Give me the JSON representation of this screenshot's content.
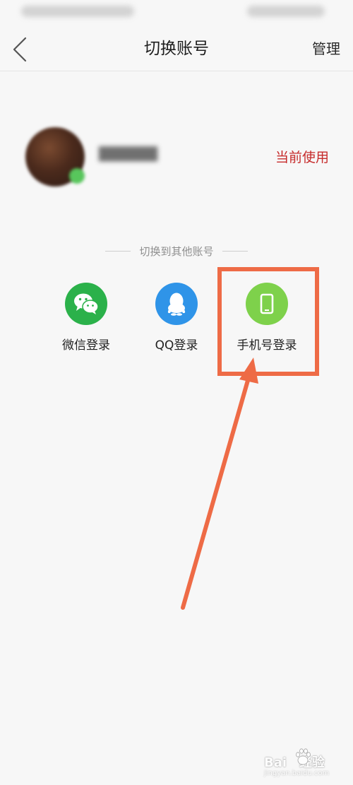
{
  "header": {
    "title": "切换账号",
    "manage_label": "管理",
    "back_icon": "chevron-left-icon"
  },
  "current_account": {
    "status_label": "当前使用"
  },
  "switch_section": {
    "label": "切换到其他账号",
    "options": [
      {
        "label": "微信登录",
        "icon": "wechat-icon",
        "color": "#2bb14a"
      },
      {
        "label": "QQ登录",
        "icon": "qq-penguin-icon",
        "color": "#2f94e8"
      },
      {
        "label": "手机号登录",
        "icon": "phone-icon",
        "color": "#7ed14b"
      }
    ]
  },
  "annotation": {
    "color": "#ee6b46",
    "highlighted_option": "手机号登录"
  },
  "watermark": {
    "brand_text": "Bai",
    "brand_suffix": "经验",
    "url": "jingyan.baidu.com"
  }
}
